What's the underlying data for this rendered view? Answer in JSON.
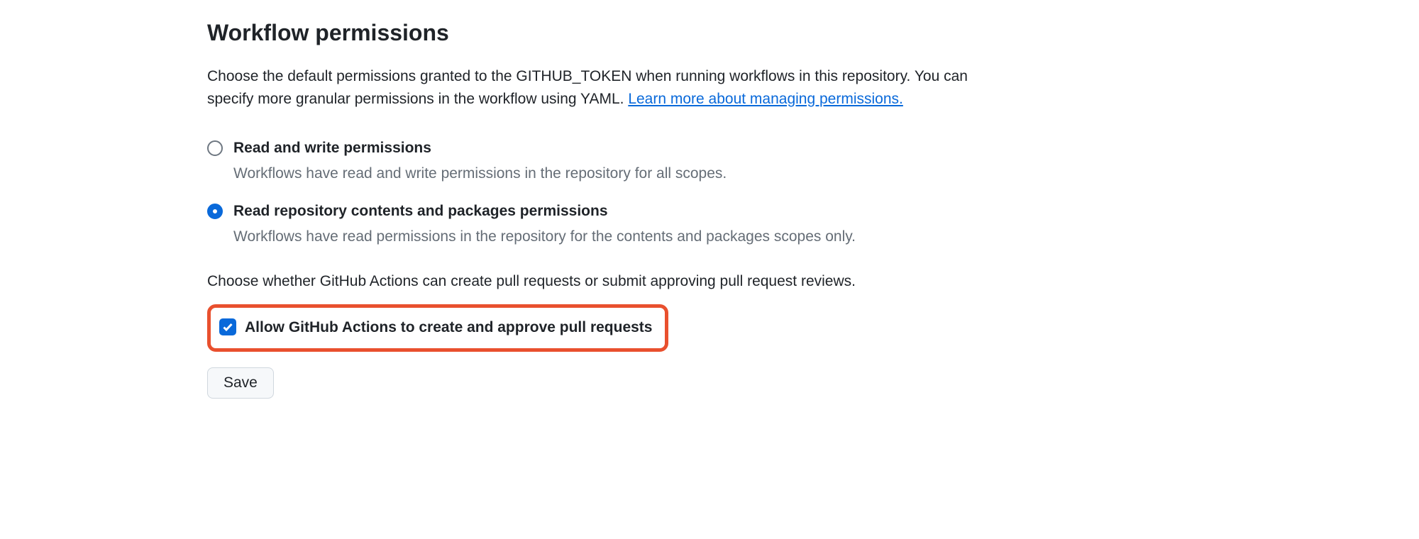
{
  "heading": "Workflow permissions",
  "description_text": "Choose the default permissions granted to the GITHUB_TOKEN when running workflows in this repository. You can specify more granular permissions in the workflow using YAML. ",
  "description_link": "Learn more about managing permissions.",
  "options": {
    "read_write": {
      "title": "Read and write permissions",
      "sub": "Workflows have read and write permissions in the repository for all scopes.",
      "selected": false
    },
    "read_only": {
      "title": "Read repository contents and packages permissions",
      "sub": "Workflows have read permissions in the repository for the contents and packages scopes only.",
      "selected": true
    }
  },
  "subdescription": "Choose whether GitHub Actions can create pull requests or submit approving pull request reviews.",
  "checkbox": {
    "label": "Allow GitHub Actions to create and approve pull requests",
    "checked": true
  },
  "save_label": "Save"
}
